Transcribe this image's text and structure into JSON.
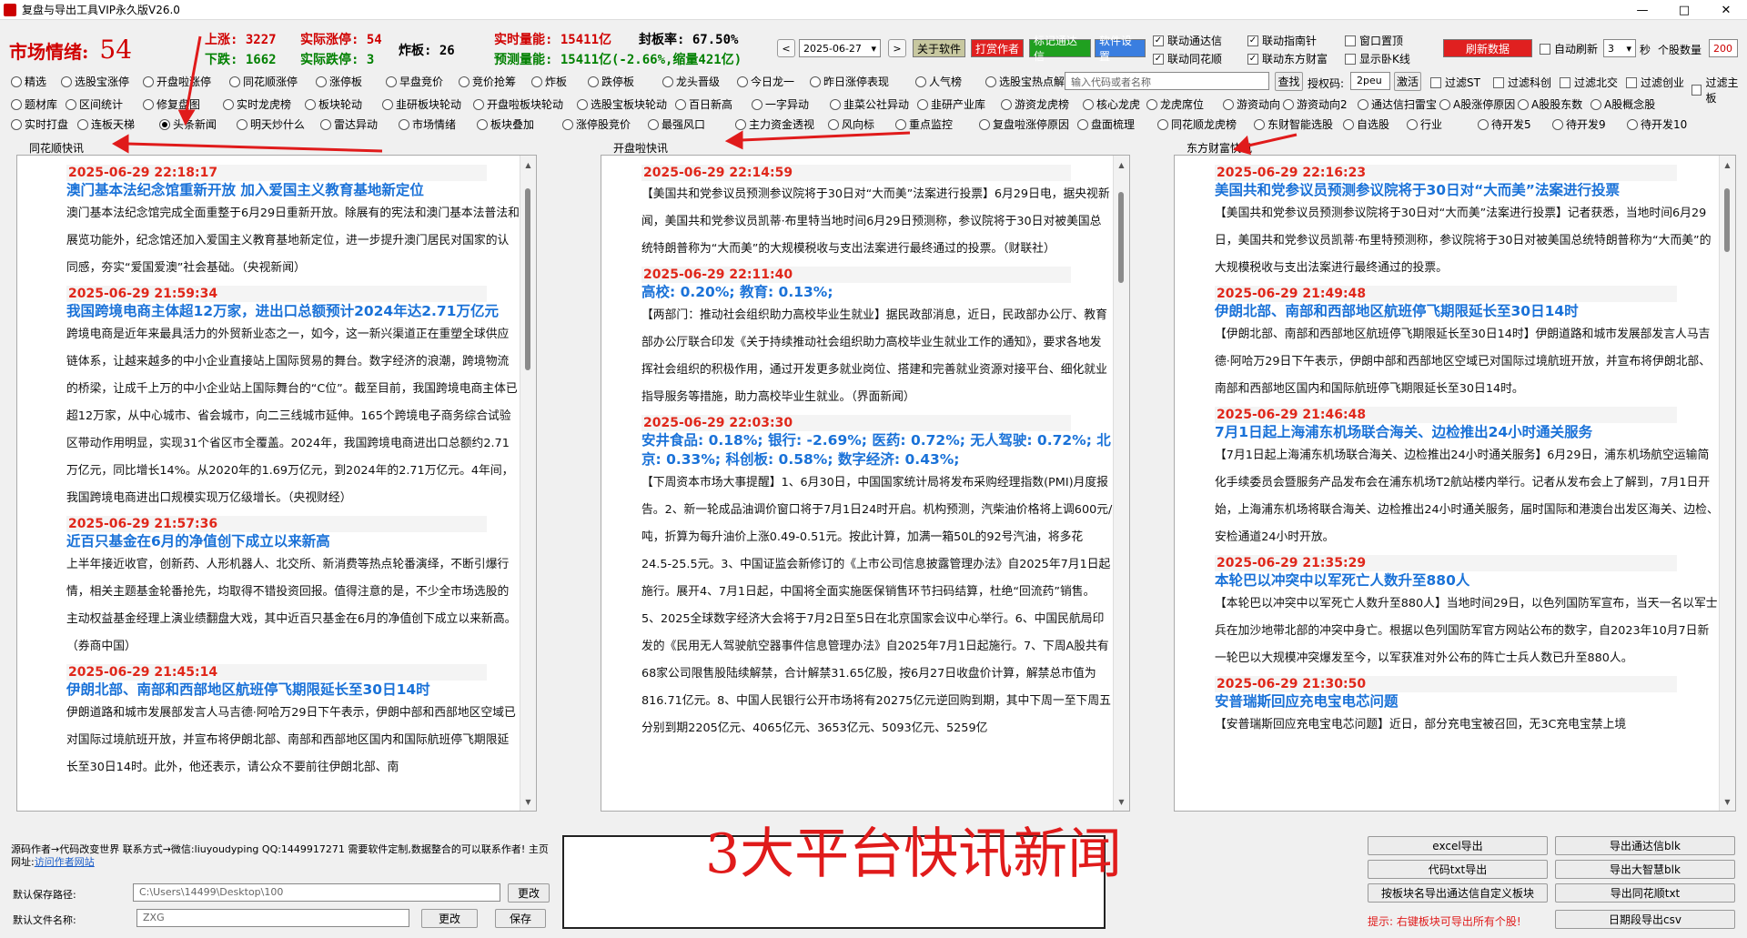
{
  "window": {
    "title": "复盘与导出工具VIP永久版V26.0",
    "min": "—",
    "max": "□",
    "close": "✕"
  },
  "market": {
    "label": "市场情绪:",
    "value": "54"
  },
  "stats": {
    "up": "上涨: 3227",
    "real_up": "实际涨停: 54",
    "down": "下跌: 1662",
    "real_down": "实际跌停: 3",
    "zhaban": "炸板: 26",
    "realtime_vol": "实时量能: 15411亿",
    "seal": "封板率: 67.50%",
    "forecast_vol": "预测量能: 15411亿(-2.66%,缩量421亿)"
  },
  "toolbar": {
    "prev": "<",
    "date": "2025-06-27",
    "next": ">",
    "about": "关于软件",
    "tip": "打赏作者",
    "mark": "标记通达信",
    "settings": "软件设置",
    "refresh": "刷新数据",
    "auto_refresh": "自动刷新",
    "interval": "3",
    "sec": "秒",
    "count_label": "个股数量",
    "count": "200",
    "colors": {
      "about": "#c8c8a0",
      "tip": "#e02020",
      "mark": "#20a020",
      "settings": "#3a7ee0",
      "refresh": "#e02020"
    }
  },
  "checks": [
    {
      "label": "联动通达信",
      "on": true
    },
    {
      "label": "联动指南针",
      "on": true
    },
    {
      "label": "窗口置顶",
      "on": false
    },
    {
      "label": "联动同花顺",
      "on": true
    },
    {
      "label": "联动东方财富",
      "on": true
    },
    {
      "label": "显示卧K线",
      "on": false
    }
  ],
  "row1": [
    "精选",
    "选股宝涨停",
    "开盘啦涨停",
    "同花顺涨停",
    "涨停板",
    "早盘竞价",
    "竞价抢筹",
    "炸板",
    "跌停板",
    "龙头晋级",
    "今日龙一",
    "昨日涨停表现",
    "人气榜",
    "选股宝热点解读"
  ],
  "search": {
    "placeholder": "输入代码或者名称",
    "btn": "查找",
    "auth_label": "授权码:",
    "auth_value": "2peu",
    "activate": "激活"
  },
  "row1_filters": [
    "过滤ST",
    "过滤科创",
    "过滤北交",
    "过滤创业",
    "过滤主板"
  ],
  "row2": [
    "题材库",
    "区间统计",
    "修复盘图",
    "实时龙虎榜",
    "板块轮动",
    "韭研板块轮动",
    "开盘啦板块轮动",
    "选股宝板块轮动",
    "百日新高",
    "一字异动",
    "韭菜公社异动",
    "韭研产业库",
    "游资龙虎榜",
    "核心龙虎",
    "龙虎席位",
    "游资动向",
    "游资动向2",
    "通达信扫雷宝",
    "A股涨停原因",
    "A股股东数",
    "A股概念股"
  ],
  "row3": [
    "实时打盘",
    "连板天梯",
    "头条新闻",
    "明天炒什么",
    "雷达异动",
    "市场情绪",
    "板块叠加",
    "涨停股竞价",
    "最强风口",
    "主力资金透视",
    "风向标",
    "重点监控",
    "复盘啦涨停原因",
    "盘面梳理",
    "同花顺龙虎榜",
    "东财智能选股",
    "自选股",
    "行业",
    "待开发5",
    "待开发9",
    "待开发10"
  ],
  "row3_selected": 2,
  "panels": [
    {
      "label": "同花顺快讯",
      "items": [
        {
          "time": "2025-06-29 22:18:17",
          "title": "澳门基本法纪念馆重新开放 加入爱国主义教育基地新定位",
          "body": "澳门基本法纪念馆完成全面重整于6月29日重新开放。除展有的宪法和澳门基本法普法和展览功能外，纪念馆还加入爱国主义教育基地新定位，进一步提升澳门居民对国家的认同感，夯实“爱国爱澳”社会基础。（央视新闻）"
        },
        {
          "time": "2025-06-29 21:59:34",
          "title": "我国跨境电商主体超12万家，进出口总额预计2024年达2.71万亿元",
          "body": "跨境电商是近年来最具活力的外贸新业态之一，如今，这一新兴渠道正在重塑全球供应链体系，让越来越多的中小企业直接站上国际贸易的舞台。数字经济的浪潮，跨境物流的桥梁，让成千上万的中小企业站上国际舞台的“C位”。截至目前，我国跨境电商主体已超12万家，从中心城市、省会城市，向二三线城市延伸。165个跨境电子商务综合试验区带动作用明显，实现31个省区市全覆盖。2024年，我国跨境电商进出口总额约2.71万亿元，同比增长14%。从2020年的1.69万亿元，到2024年的2.71万亿元。4年间，我国跨境电商进出口规模实现万亿级增长。（央视财经）"
        },
        {
          "time": "2025-06-29 21:57:36",
          "title": "近百只基金在6月的净值创下成立以来新高",
          "body": "上半年接近收官，创新药、人形机器人、北交所、新消费等热点轮番演绎，不断引爆行情，相关主题基金轮番抢先，均取得不错投资回报。值得注意的是，不少全市场选股的主动权益基金经理上演业绩翻盘大戏，其中近百只基金在6月的净值创下成立以来新高。（券商中国）"
        },
        {
          "time": "2025-06-29 21:45:14",
          "title": "伊朗北部、南部和西部地区航班停飞期限延长至30日14时",
          "body": "伊朗道路和城市发展部发言人马吉德·阿哈万29日下午表示，伊朗中部和西部地区空域已对国际过境航班开放，并宣布将伊朗北部、南部和西部地区国内和国际航班停飞期限延长至30日14时。此外，他还表示，请公众不要前往伊朗北部、南"
        }
      ]
    },
    {
      "label": "开盘啦快讯",
      "items": [
        {
          "time": "2025-06-29 22:14:59",
          "title": "",
          "body": "【美国共和党参议员预测参议院将于30日对“大而美”法案进行投票】6月29日电，据央视新闻，美国共和党参议员凯蒂·布里特当地时间6月29日预测称，参议院将于30日对被美国总统特朗普称为“大而美”的大规模税收与支出法案进行最终通过的投票。（财联社）"
        },
        {
          "time": "2025-06-29 22:11:40",
          "title": "高校: 0.20%; 教育: 0.13%;",
          "body": "【两部门：推动社会组织助力高校毕业生就业】据民政部消息，近日，民政部办公厅、教育部办公厅联合印发《关于持续推动社会组织助力高校毕业生就业工作的通知》，要求各地发挥社会组织的积极作用，通过开发更多就业岗位、搭建和完善就业资源对接平台、细化就业指导服务等措施，助力高校毕业生就业。（界面新闻）"
        },
        {
          "time": "2025-06-29 22:03:30",
          "title": "安井食品: 0.18%; 银行: -2.69%; 医药: 0.72%; 无人驾驶: 0.72%; 北京: 0.33%; 科创板: 0.58%; 数字经济: 0.43%;",
          "body": "【下周资本市场大事提醒】1、6月30日，中国国家统计局将发布采购经理指数(PMI)月度报告。2、新一轮成品油调价窗口将于7月1日24时开启。机构预测，汽柴油价格将上调600元/吨，折算为每升油价上涨0.49-0.51元。按此计算，加满一箱50L的92号汽油，将多花24.5-25.5元。3、中国证监会新修订的《上市公司信息披露管理办法》自2025年7月1日起施行。展开4、7月1日起，中国将全面实施医保销售环节扫码结算，杜绝“回流药”销售。5、2025全球数字经济大会将于7月2日至5日在北京国家会议中心举行。6、中国民航局印发的《民用无人驾驶航空器事件信息管理办法》自2025年7月1日起施行。7、下周A股共有68家公司限售股陆续解禁，合计解禁31.65亿股，按6月27日收盘价计算，解禁总市值为816.71亿元。8、中国人民银行公开市场将有20275亿元逆回购到期，其中下周一至下周五分别到期2205亿元、4065亿元、3653亿元、5093亿元、5259亿"
        }
      ]
    },
    {
      "label": "东方财富快讯",
      "items": [
        {
          "time": "2025-06-29 22:16:23",
          "title": "美国共和党参议员预测参议院将于30日对“大而美”法案进行投票",
          "body": "【美国共和党参议员预测参议院将于30日对“大而美”法案进行投票】记者获悉，当地时间6月29日，美国共和党参议员凯蒂·布里特预测称，参议院将于30日对被美国总统特朗普称为“大而美”的大规模税收与支出法案进行最终通过的投票。"
        },
        {
          "time": "2025-06-29 21:49:48",
          "title": "伊朗北部、南部和西部地区航班停飞期限延长至30日14时",
          "body": "【伊朗北部、南部和西部地区航班停飞期限延长至30日14时】伊朗道路和城市发展部发言人马吉德·阿哈万29日下午表示，伊朗中部和西部地区空域已对国际过境航班开放，并宣布将伊朗北部、南部和西部地区国内和国际航班停飞期限延长至30日14时。"
        },
        {
          "time": "2025-06-29 21:46:48",
          "title": "7月1日起上海浦东机场联合海关、边检推出24小时通关服务",
          "body": "【7月1日起上海浦东机场联合海关、边检推出24小时通关服务】6月29日，浦东机场航空运输简化手续委员会暨服务产品发布会在浦东机场T2航站楼内举行。记者从发布会上了解到，7月1日开始，上海浦东机场将联合海关、边检推出24小时通关服务，届时国际和港澳台出发区海关、边检、安检通道24小时开放。"
        },
        {
          "time": "2025-06-29 21:35:29",
          "title": "本轮巴以冲突中以军死亡人数升至880人",
          "body": "【本轮巴以冲突中以军死亡人数升至880人】当地时间29日，以色列国防军宣布，当天一名以军士兵在加沙地带北部的冲突中身亡。根据以色列国防军官方网站公布的数字，自2023年10月7日新一轮巴以大规模冲突爆发至今，以军获准对外公布的阵亡士兵人数已升至880人。"
        },
        {
          "time": "2025-06-29 21:30:50",
          "title": "安普瑞斯回应充电宝电芯问题",
          "body": "【安普瑞斯回应充电宝电芯问题】近日，部分充电宝被召回，无3C充电宝禁上境"
        }
      ]
    }
  ],
  "footer": {
    "author": "源码作者→代码改变世界 联系方式→微信:liuyoudyping QQ:1449917271 需要软件定制,数据整合的可以联系作者! 主页网址:",
    "link": "访问作者网站",
    "path_label": "默认保存路径:",
    "path": "C:\\Users\\14499\\Desktop\\100",
    "change": "更改",
    "file_label": "默认文件名称:",
    "file": "ZXG",
    "change2": "更改",
    "save": "保存"
  },
  "overlay": {
    "big_title": "3大平台快讯新闻"
  },
  "export": [
    "excel导出",
    "导出通达信blk",
    "代码txt导出",
    "导出大智慧blk",
    "按板块名导出通达信自定义板块",
    "导出同花顺txt",
    "",
    "日期段导出csv"
  ],
  "hint": "提示: 右键板块可导出所有个股!"
}
